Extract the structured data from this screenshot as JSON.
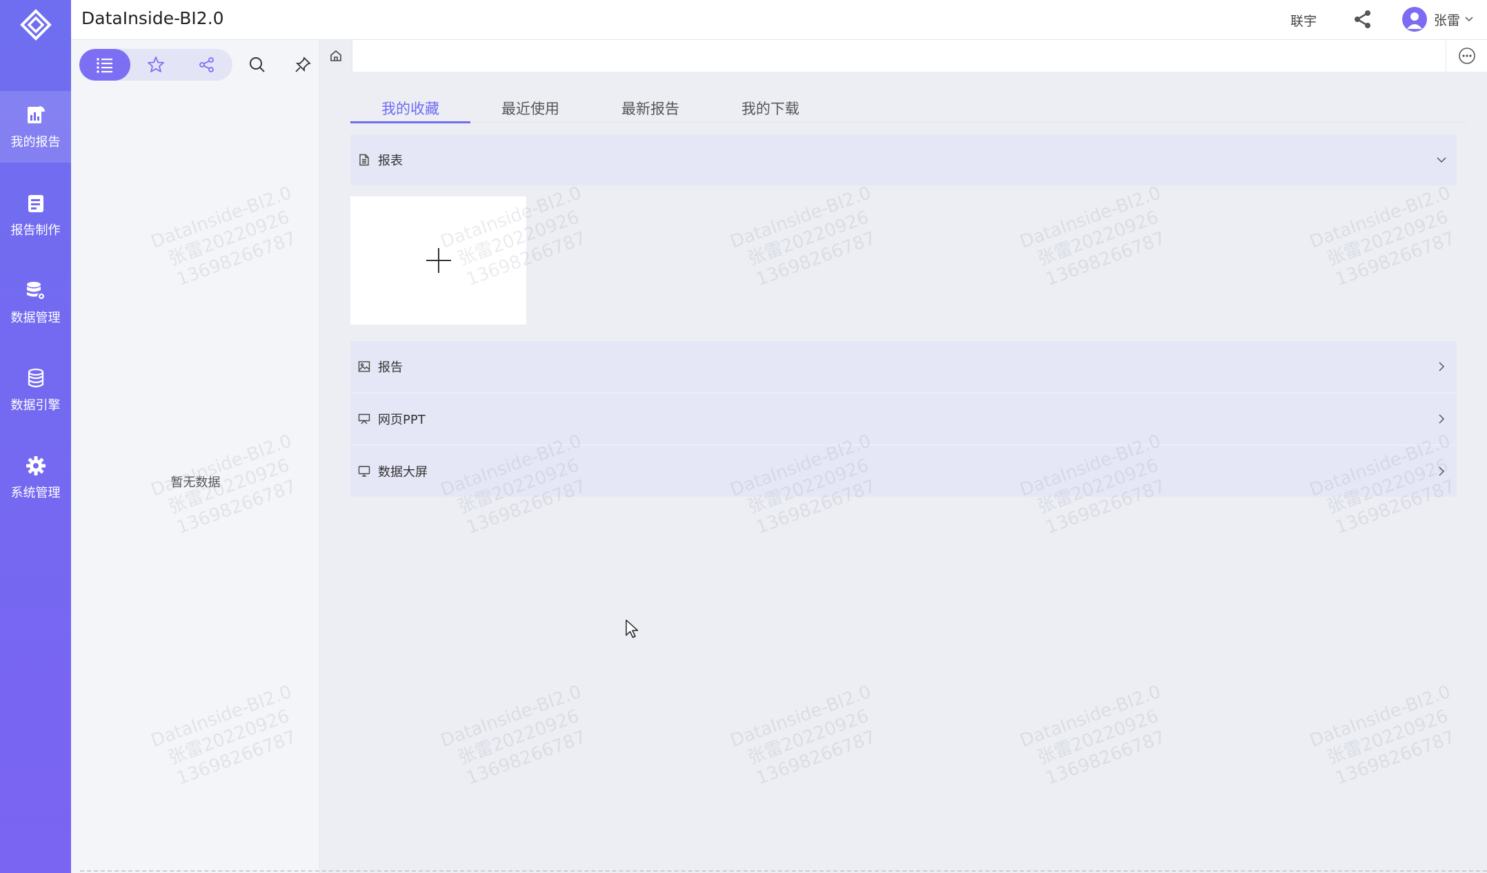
{
  "app": {
    "title": "DataInside-BI2.0"
  },
  "topbar": {
    "link": "联宇",
    "user_name": "张雷"
  },
  "leftnav": {
    "items": [
      {
        "label": "我的报告",
        "icon": "report-chart-icon"
      },
      {
        "label": "报告制作",
        "icon": "document-edit-icon"
      },
      {
        "label": "数据管理",
        "icon": "database-gear-icon"
      },
      {
        "label": "数据引擎",
        "icon": "database-icon"
      },
      {
        "label": "系统管理",
        "icon": "gear-icon"
      }
    ]
  },
  "panel": {
    "empty_text": "暂无数据"
  },
  "tabs": [
    {
      "label": "我的收藏"
    },
    {
      "label": "最近使用"
    },
    {
      "label": "最新报告"
    },
    {
      "label": "我的下载"
    }
  ],
  "sections": [
    {
      "label": "报表",
      "icon": "document-icon",
      "state": "expanded"
    },
    {
      "label": "报告",
      "icon": "image-icon",
      "state": "collapsed"
    },
    {
      "label": "网页PPT",
      "icon": "presentation-icon",
      "state": "collapsed"
    },
    {
      "label": "数据大屏",
      "icon": "monitor-icon",
      "state": "collapsed"
    }
  ],
  "watermark": {
    "lines": [
      "DataInside-BI2.0",
      "张雷20220926",
      "13698266787"
    ]
  },
  "colors": {
    "accent": "#6d6cf2",
    "nav_bg": "#7268f1",
    "section_bg": "#e6e7f6"
  }
}
